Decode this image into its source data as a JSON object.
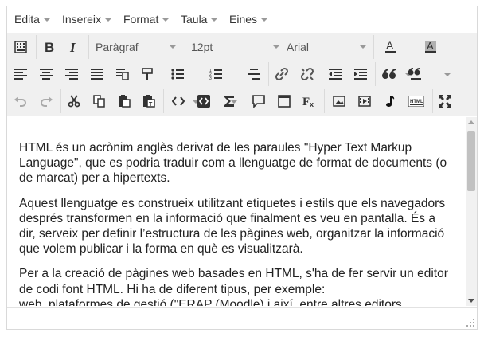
{
  "menubar": {
    "items": [
      {
        "label": "Edita"
      },
      {
        "label": "Insereix"
      },
      {
        "label": "Format"
      },
      {
        "label": "Taula"
      },
      {
        "label": "Eines"
      }
    ]
  },
  "toolbar": {
    "block_format": "Paràgraf",
    "font_size": "12pt",
    "font_family": "Arial",
    "text_color_icon": "A",
    "bg_color_icon": "A",
    "bg_color": "#b0b0b0"
  },
  "content": {
    "paragraphs": [
      "HTML és un acrònim anglès derivat de les paraules \"Hyper Text Markup Language\", que es podria traduir com a llenguatge de format de documents (o de marcat) per a hipertexts.",
      "Aquest llenguatge es construeix utilitzant etiquetes i estils que els navegadors després transformen en la informació que finalment es veu en pantalla. És a dir, serveix per definir l’estructura de les pàgines web, organitzar la informació que volem publicar i la forma en què es visualitzarà.",
      "Per a la creació de pàgines web basades en HTML, s'ha de fer servir un editor de codi font HTML. Hi ha de diferent tipus, per exemple:",
      "    web, plataformes de gestió (\"ERAP (Moodle) i així, entre altres editors"
    ]
  }
}
